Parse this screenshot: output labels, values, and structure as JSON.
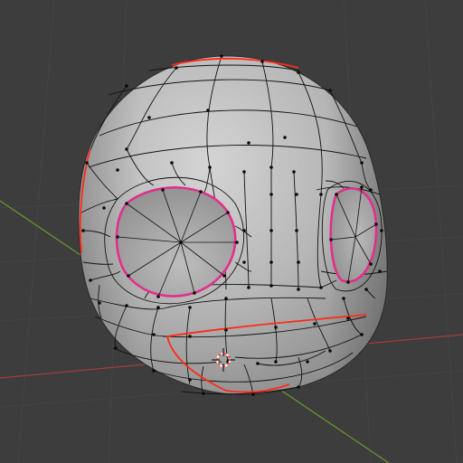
{
  "viewport": {
    "background": "#3d3d3d",
    "grid_line_color": "#474747",
    "x_axis_color": "#a33c3c",
    "y_axis_color": "#6b9b2e"
  },
  "mesh": {
    "shading_light": "#c9c9c9",
    "shading_mid": "#a9a9a9",
    "shading_dark": "#7e7e7e",
    "wire_color": "#121212",
    "seam_color": "#ff2a1a",
    "selected_loop_color": "#e0308c",
    "selected_inner_color": "#7a3cff",
    "vertex_color": "#0a0a0a"
  },
  "cursor_3d": {
    "ring_color_a": "#ff4a3a",
    "ring_color_b": "#ffffff",
    "icon": "3d-cursor-icon"
  }
}
